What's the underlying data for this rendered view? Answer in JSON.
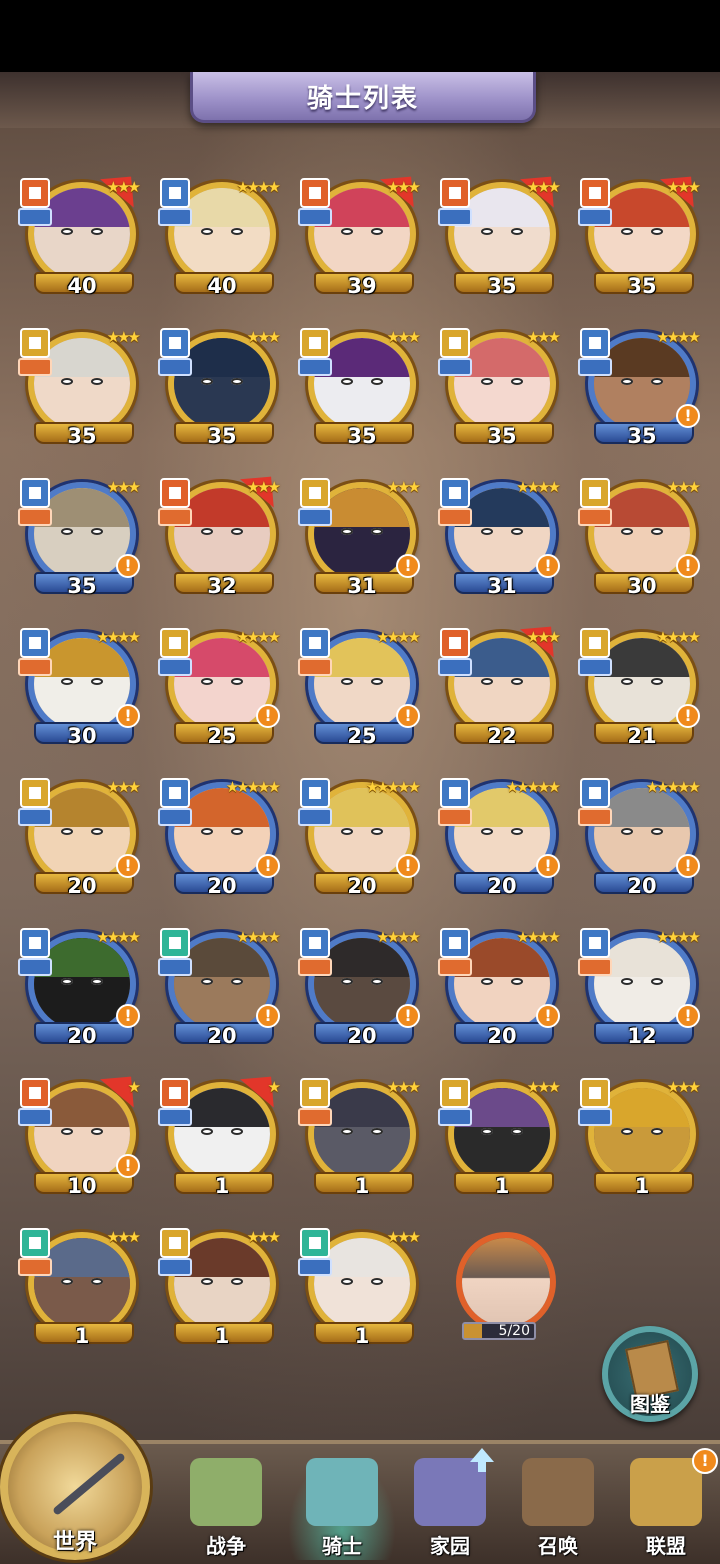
{
  "header": {
    "title": "骑士列表"
  },
  "colors": {
    "gold_frame": "#e0b33a",
    "blue_frame": "#4f7bc8",
    "alert": "#f08a1c",
    "active_tab_glow": "#5af0d2"
  },
  "knights": [
    {
      "level": "40",
      "stars": "★★★",
      "frame": "gold",
      "badge": "orange",
      "role": "blue",
      "alert": false,
      "ribbon": true,
      "hair": "#6b3f8f",
      "skin": "#e8d6c8"
    },
    {
      "level": "40",
      "stars": "★★★★",
      "frame": "gold",
      "badge": "blue",
      "role": "blue",
      "alert": false,
      "ribbon": false,
      "hair": "#e8d9a8",
      "skin": "#f2dcc4"
    },
    {
      "level": "39",
      "stars": "★★★",
      "frame": "gold",
      "badge": "orange",
      "role": "blue",
      "alert": false,
      "ribbon": true,
      "hair": "#d0435a",
      "skin": "#f2d6c4"
    },
    {
      "level": "35",
      "stars": "★★★",
      "frame": "gold",
      "badge": "orange",
      "role": "blue",
      "alert": false,
      "ribbon": true,
      "hair": "#e9e6ee",
      "skin": "#f0dccd"
    },
    {
      "level": "35",
      "stars": "★★★",
      "frame": "gold",
      "badge": "orange",
      "role": "blue",
      "alert": false,
      "ribbon": true,
      "hair": "#c8482c",
      "skin": "#f3d8c6"
    },
    {
      "level": "35",
      "stars": "★★★",
      "frame": "gold",
      "badge": "gold",
      "role": "orange",
      "alert": false,
      "ribbon": false,
      "hair": "#d8d6cf",
      "skin": "#efd9c8"
    },
    {
      "level": "35",
      "stars": "★★★",
      "frame": "gold",
      "badge": "blue",
      "role": "blue",
      "alert": false,
      "ribbon": false,
      "hair": "#1e2e4a",
      "skin": "#2a3852"
    },
    {
      "level": "35",
      "stars": "★★★",
      "frame": "gold",
      "badge": "gold",
      "role": "blue",
      "alert": false,
      "ribbon": false,
      "hair": "#5b2a78",
      "skin": "#ececf0"
    },
    {
      "level": "35",
      "stars": "★★★",
      "frame": "gold",
      "badge": "gold",
      "role": "blue",
      "alert": false,
      "ribbon": false,
      "hair": "#d46a6a",
      "skin": "#f4d8cf"
    },
    {
      "level": "35",
      "stars": "★★★★",
      "frame": "blue",
      "badge": "blue",
      "role": "blue",
      "alert": true,
      "ribbon": false,
      "hair": "#5a3a22",
      "skin": "#b08060"
    },
    {
      "level": "35",
      "stars": "★★★",
      "frame": "blue",
      "badge": "blue",
      "role": "orange",
      "alert": true,
      "ribbon": false,
      "hair": "#9e8f74",
      "skin": "#d8cfc0"
    },
    {
      "level": "32",
      "stars": "★★★",
      "frame": "gold",
      "badge": "orange",
      "role": "orange",
      "alert": false,
      "ribbon": true,
      "hair": "#c23a2a",
      "skin": "#e8ccc0"
    },
    {
      "level": "31",
      "stars": "★★★",
      "frame": "gold",
      "badge": "gold",
      "role": "blue",
      "alert": true,
      "ribbon": false,
      "hair": "#c98c32",
      "skin": "#2b2440"
    },
    {
      "level": "31",
      "stars": "★★★★",
      "frame": "blue",
      "badge": "blue",
      "role": "orange",
      "alert": true,
      "ribbon": false,
      "hair": "#243a5c",
      "skin": "#f0d6c3"
    },
    {
      "level": "30",
      "stars": "★★★",
      "frame": "gold",
      "badge": "gold",
      "role": "orange",
      "alert": true,
      "ribbon": false,
      "hair": "#b84a34",
      "skin": "#f0cfb6"
    },
    {
      "level": "30",
      "stars": "★★★★",
      "frame": "blue",
      "badge": "blue",
      "role": "orange",
      "alert": true,
      "ribbon": false,
      "hair": "#c9962e",
      "skin": "#f0eee8"
    },
    {
      "level": "25",
      "stars": "★★★★",
      "frame": "gold",
      "badge": "gold",
      "role": "blue",
      "alert": true,
      "ribbon": false,
      "hair": "#d64a6a",
      "skin": "#f3d4cd"
    },
    {
      "level": "25",
      "stars": "★★★★",
      "frame": "blue",
      "badge": "blue",
      "role": "orange",
      "alert": true,
      "ribbon": false,
      "hair": "#e2c35a",
      "skin": "#f0d8c6"
    },
    {
      "level": "22",
      "stars": "★★★",
      "frame": "gold",
      "badge": "orange",
      "role": "blue",
      "alert": false,
      "ribbon": true,
      "hair": "#3b5c8c",
      "skin": "#f0d6c2"
    },
    {
      "level": "21",
      "stars": "★★★★",
      "frame": "gold",
      "badge": "gold",
      "role": "blue",
      "alert": true,
      "ribbon": false,
      "hair": "#3a3a3a",
      "skin": "#e8e2d8"
    },
    {
      "level": "20",
      "stars": "★★★",
      "frame": "gold",
      "badge": "gold",
      "role": "blue",
      "alert": true,
      "ribbon": false,
      "hair": "#b5842e",
      "skin": "#f1d4b5"
    },
    {
      "level": "20",
      "stars": "★★★★★",
      "frame": "blue",
      "badge": "blue",
      "role": "blue",
      "alert": true,
      "ribbon": false,
      "hair": "#d3652c",
      "skin": "#f3d2b8"
    },
    {
      "level": "20",
      "stars": "★★★★★",
      "frame": "gold",
      "badge": "blue",
      "role": "blue",
      "alert": true,
      "ribbon": false,
      "hair": "#e0c25a",
      "skin": "#f1d6c0"
    },
    {
      "level": "20",
      "stars": "★★★★★",
      "frame": "blue",
      "badge": "blue",
      "role": "orange",
      "alert": true,
      "ribbon": false,
      "hair": "#e2c96a",
      "skin": "#f2d9c4"
    },
    {
      "level": "20",
      "stars": "★★★★★",
      "frame": "blue",
      "badge": "blue",
      "role": "orange",
      "alert": true,
      "ribbon": false,
      "hair": "#8a8a8a",
      "skin": "#e8c8ae"
    },
    {
      "level": "20",
      "stars": "★★★★",
      "frame": "blue",
      "badge": "blue",
      "role": "blue",
      "alert": true,
      "ribbon": false,
      "hair": "#3d6b2e",
      "skin": "#1c1c1c"
    },
    {
      "level": "20",
      "stars": "★★★★",
      "frame": "blue",
      "badge": "teal",
      "role": "blue",
      "alert": true,
      "ribbon": false,
      "hair": "#5a4a3a",
      "skin": "#9b7a5c"
    },
    {
      "level": "20",
      "stars": "★★★★",
      "frame": "blue",
      "badge": "blue",
      "role": "orange",
      "alert": true,
      "ribbon": false,
      "hair": "#2e2a2a",
      "skin": "#5a4a40"
    },
    {
      "level": "20",
      "stars": "★★★★",
      "frame": "blue",
      "badge": "blue",
      "role": "orange",
      "alert": true,
      "ribbon": false,
      "hair": "#9a4a2a",
      "skin": "#f1d3c0"
    },
    {
      "level": "12",
      "stars": "★★★★",
      "frame": "blue",
      "badge": "blue",
      "role": "orange",
      "alert": true,
      "ribbon": false,
      "hair": "#e8e2d8",
      "skin": "#f0ece6"
    },
    {
      "level": "10",
      "stars": "★",
      "frame": "gold",
      "badge": "orange",
      "role": "blue",
      "alert": true,
      "ribbon": true,
      "hair": "#8a5a3a",
      "skin": "#f0d4c0"
    },
    {
      "level": "1",
      "stars": "★",
      "frame": "gold",
      "badge": "orange",
      "role": "blue",
      "alert": false,
      "ribbon": true,
      "hair": "#2a2a2e",
      "skin": "#f0f0f0"
    },
    {
      "level": "1",
      "stars": "★★★",
      "frame": "gold",
      "badge": "gold",
      "role": "orange",
      "alert": false,
      "ribbon": false,
      "hair": "#3a3a4a",
      "skin": "#5a5a66"
    },
    {
      "level": "1",
      "stars": "★★★",
      "frame": "gold",
      "badge": "gold",
      "role": "blue",
      "alert": false,
      "ribbon": false,
      "hair": "#6b4a8a",
      "skin": "#2a2a2a"
    },
    {
      "level": "1",
      "stars": "★★★",
      "frame": "gold",
      "badge": "gold",
      "role": "blue",
      "alert": false,
      "ribbon": false,
      "hair": "#d9a62c",
      "skin": "#c99a3a"
    },
    {
      "level": "1",
      "stars": "★★★",
      "frame": "gold",
      "badge": "teal",
      "role": "orange",
      "alert": false,
      "ribbon": false,
      "hair": "#5a6a8a",
      "skin": "#7a5a4a"
    },
    {
      "level": "1",
      "stars": "★★★",
      "frame": "gold",
      "badge": "gold",
      "role": "blue",
      "alert": false,
      "ribbon": false,
      "hair": "#6a3a2a",
      "skin": "#e8d4c4"
    },
    {
      "level": "1",
      "stars": "★★★",
      "frame": "gold",
      "badge": "teal",
      "role": "blue",
      "alert": false,
      "ribbon": false,
      "hair": "#e8e4e0",
      "skin": "#f0e2d8"
    }
  ],
  "fragment": {
    "progress_text": "5/20",
    "progress": 0.25
  },
  "codex": {
    "label": "图鉴"
  },
  "nav": {
    "world": "世界",
    "items": [
      {
        "label": "战争",
        "icon": "map-icon",
        "color": "#8fae6a"
      },
      {
        "label": "骑士",
        "icon": "knight-icon",
        "color": "#6fb4b8",
        "active": true
      },
      {
        "label": "家园",
        "icon": "house-icon",
        "color": "#7a78b8"
      },
      {
        "label": "召唤",
        "icon": "train-icon",
        "color": "#8a6a4a"
      },
      {
        "label": "联盟",
        "icon": "alliance-icon",
        "color": "#caa04a"
      }
    ],
    "alert_mark": "!"
  },
  "alert_mark": "!"
}
